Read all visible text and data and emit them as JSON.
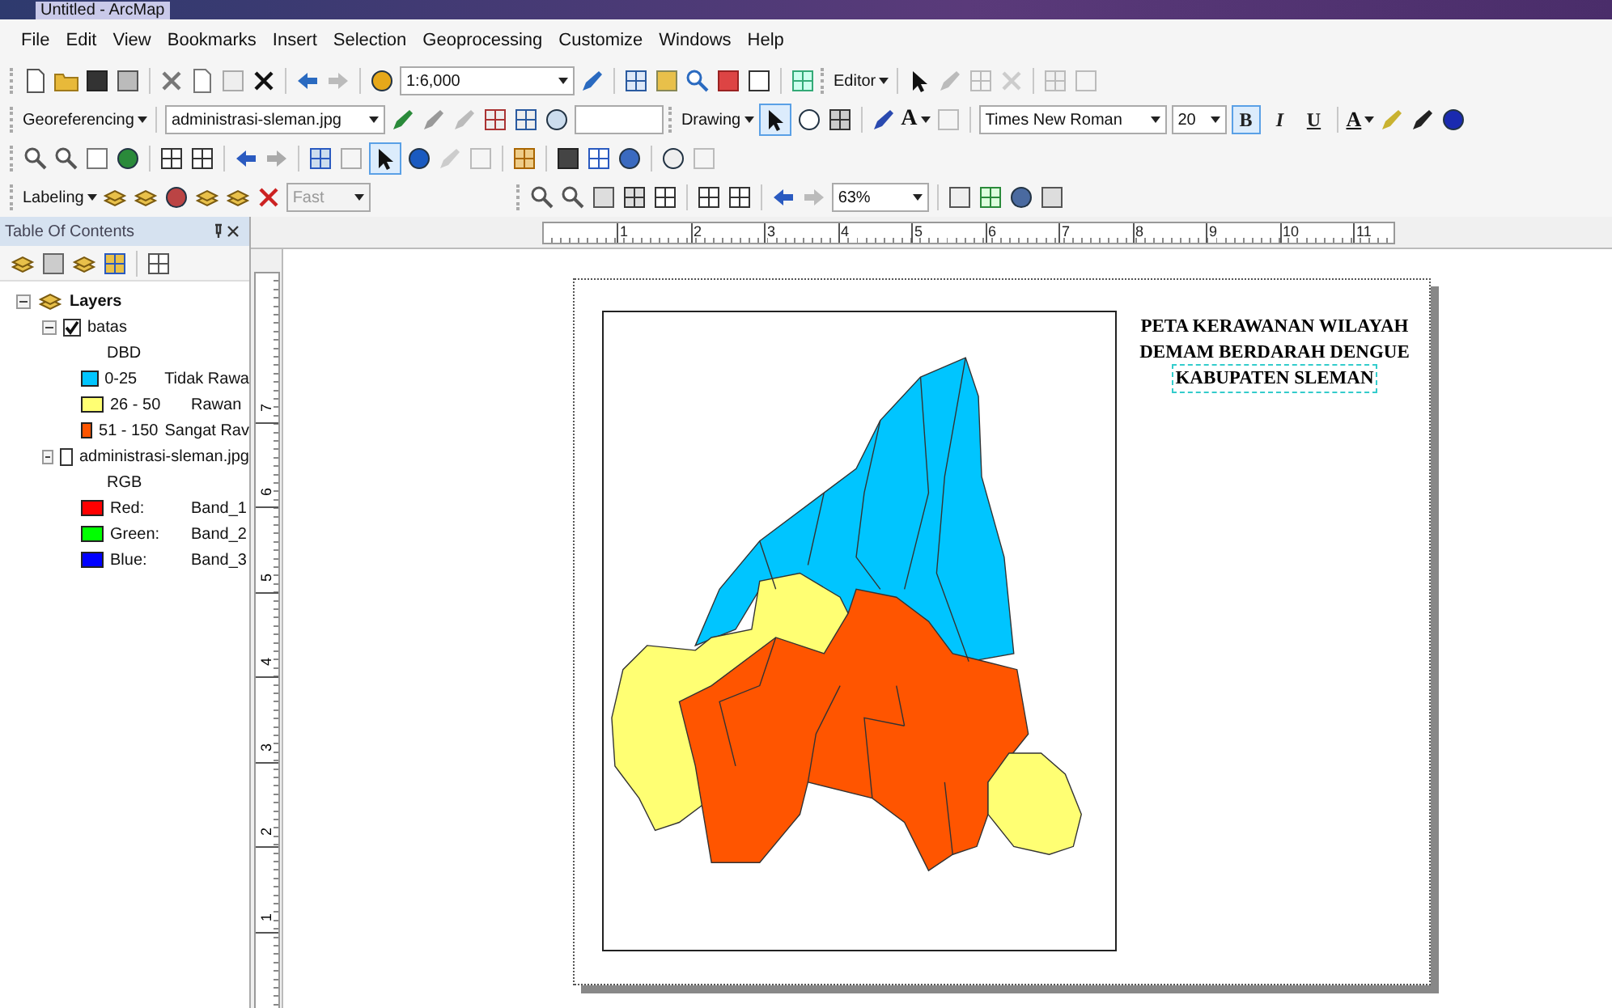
{
  "window": {
    "title": "Untitled - ArcMap"
  },
  "menu": [
    "File",
    "Edit",
    "View",
    "Bookmarks",
    "Insert",
    "Selection",
    "Geoprocessing",
    "Customize",
    "Windows",
    "Help"
  ],
  "standard_toolbar": {
    "scale": "1:6,000",
    "editor": "Editor"
  },
  "georef_toolbar": {
    "label": "Georeferencing",
    "layer": "administrasi-sleman.jpg"
  },
  "drawing_toolbar": {
    "label": "Drawing",
    "text_tool": "A",
    "font": "Times New Roman",
    "size": "20",
    "styles": [
      {
        "text": "B",
        "selected": true
      },
      {
        "text": "I",
        "selected": false
      },
      {
        "text": "U",
        "selected": false
      }
    ],
    "font_color": "A"
  },
  "tools_toolbar": {
    "select_selected": true
  },
  "labeling_toolbar": {
    "label": "Labeling",
    "quality": "Fast",
    "quality_disabled": true
  },
  "layout_toolbar": {
    "zoom": "63%"
  },
  "toc": {
    "title": "Table Of Contents",
    "root": "Layers",
    "root_expanded": true,
    "layers": [
      {
        "name": "batas",
        "checked": true,
        "expanded": true,
        "field": "DBD",
        "classes": [
          {
            "range": "0-25",
            "label": "Tidak Rawa",
            "color": "#00c5ff"
          },
          {
            "range": "26 - 50",
            "label": "Rawan",
            "color": "#ffff73"
          },
          {
            "range": "51 - 150",
            "label": "Sangat Rav",
            "color": "#ff5500"
          }
        ]
      },
      {
        "name": "administrasi-sleman.jpg",
        "checked": false,
        "expanded": true,
        "field": "RGB",
        "classes": [
          {
            "range": "Red:",
            "label": "Band_1",
            "color": "#ff0000"
          },
          {
            "range": "Green:",
            "label": "Band_2",
            "color": "#00ff00"
          },
          {
            "range": "Blue:",
            "label": "Band_3",
            "color": "#0000ff"
          }
        ]
      }
    ]
  },
  "h_ruler": [
    "1",
    "2",
    "3",
    "4",
    "5",
    "6",
    "7",
    "8",
    "9",
    "10",
    "11"
  ],
  "v_ruler": [
    "7",
    "6",
    "5",
    "4",
    "3",
    "2",
    "1"
  ],
  "map_title": [
    {
      "text": "PETA KERAWANAN WILAYAH",
      "selected": false
    },
    {
      "text": "DEMAM BERDARAH DENGUE",
      "selected": false
    },
    {
      "text": "KABUPATEN SLEMAN",
      "selected": true
    }
  ]
}
